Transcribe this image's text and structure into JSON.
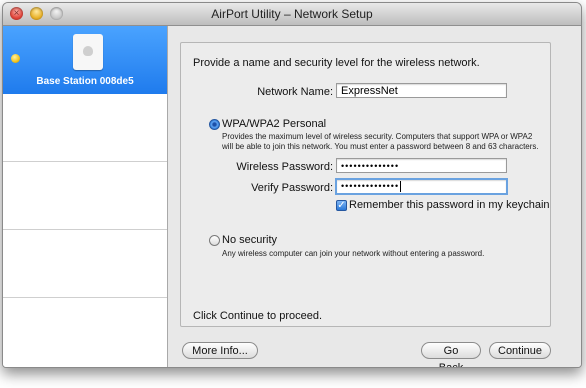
{
  "window": {
    "title": "AirPort Utility – Network Setup"
  },
  "sidebar": {
    "items": [
      {
        "label": "Base Station 008de5",
        "icon": "airport-express-icon"
      }
    ]
  },
  "form": {
    "heading": "Provide a name and security level for the wireless network.",
    "network_name_label": "Network Name:",
    "network_name_value": "ExpressNet",
    "wpa": {
      "title": "WPA/WPA2 Personal",
      "description": "Provides the maximum level of wireless security. Computers that support WPA or WPA2 will be able to join this network. You must enter a password between 8 and 63 characters.",
      "selected": true
    },
    "password_label": "Wireless Password:",
    "password_value": "••••••••••••••",
    "verify_label": "Verify Password:",
    "verify_value": "••••••••••••••",
    "remember_label": "Remember this password in my keychain",
    "remember_checked": true,
    "no_security": {
      "title": "No security",
      "description": "Any wireless computer can join your network without entering a password.",
      "selected": false
    },
    "footer_text": "Click Continue to proceed."
  },
  "buttons": {
    "more_info": "More Info...",
    "go_back": "Go Back",
    "continue": "Continue"
  },
  "colors": {
    "selection": "#2f8cf5",
    "status_dot": "#f1c21b",
    "focus_ring": "#6aa2e0"
  }
}
